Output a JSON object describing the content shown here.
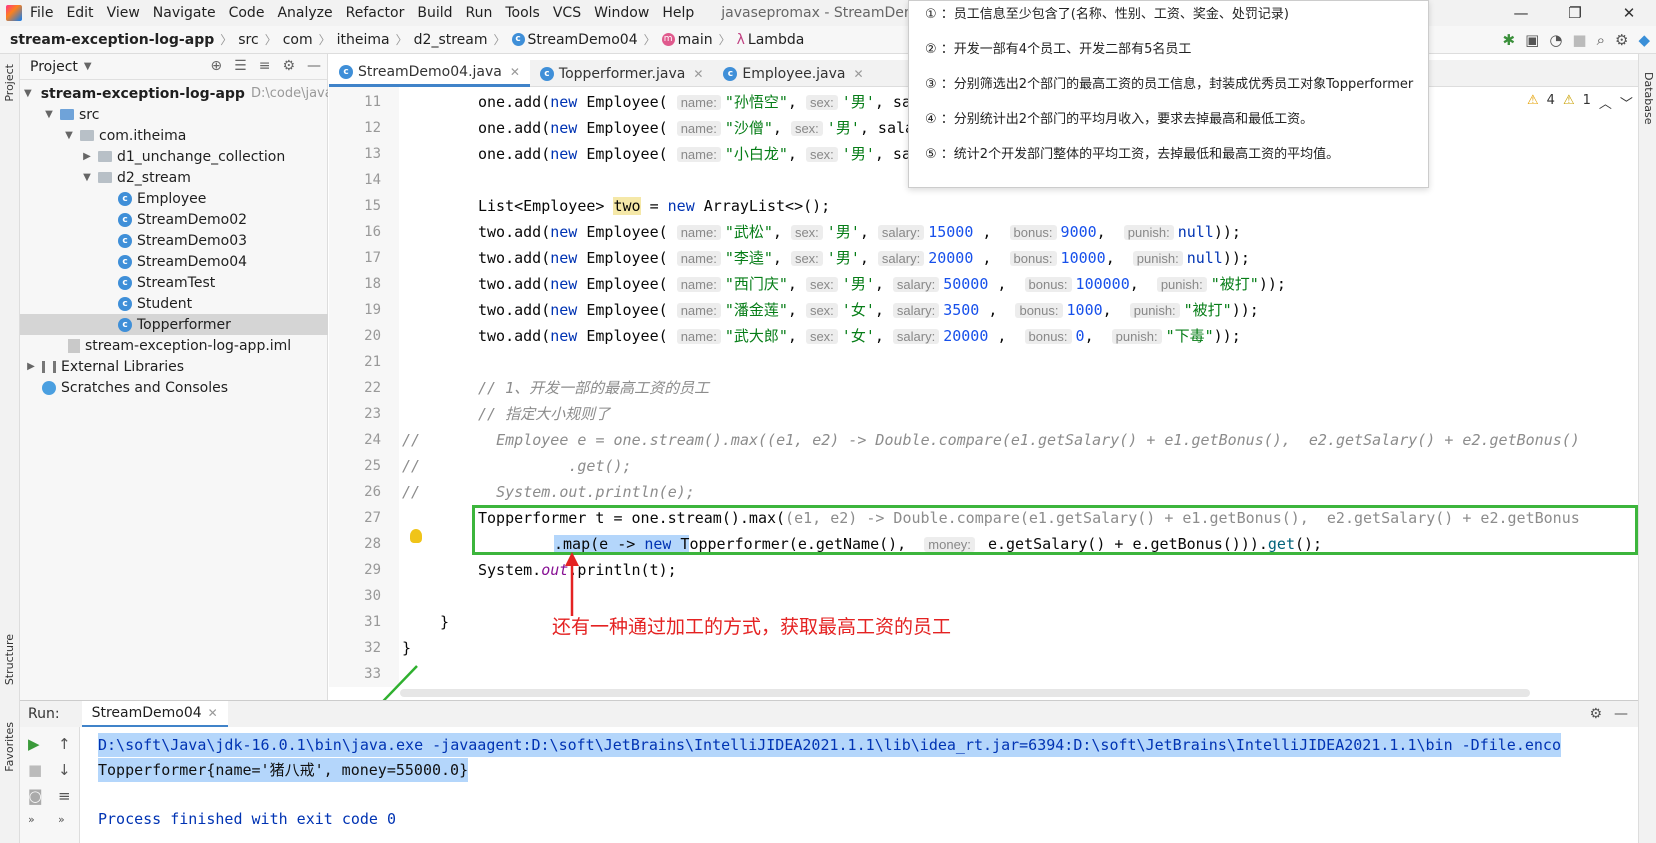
{
  "menubar": {
    "items": [
      "File",
      "Edit",
      "View",
      "Navigate",
      "Code",
      "Analyze",
      "Refactor",
      "Build",
      "Run",
      "Tools",
      "VCS",
      "Window",
      "Help"
    ],
    "title": "javasepromax - StreamDemo04.jav"
  },
  "window": {
    "minimize": "—",
    "restore": "❐",
    "close": "✕"
  },
  "breadcrumb": {
    "project": "stream-exception-log-app",
    "items": [
      "src",
      "com",
      "itheima",
      "d2_stream",
      "StreamDemo04",
      "main",
      "Lambda"
    ]
  },
  "project_panel": {
    "title": "Project",
    "root": "stream-exception-log-app",
    "root_path": "D:\\code\\java",
    "src": "src",
    "pkg": "com.itheima",
    "folders": [
      "d1_unchange_collection",
      "d2_stream"
    ],
    "classes": [
      "Employee",
      "StreamDemo02",
      "StreamDemo03",
      "StreamDemo04",
      "StreamTest",
      "Student",
      "Topperformer"
    ],
    "iml": "stream-exception-log-app.iml",
    "external": "External Libraries",
    "scratches": "Scratches and Consoles"
  },
  "side_labels": {
    "project": "Project",
    "structure": "Structure",
    "favorites": "Favorites",
    "database": "Database"
  },
  "tabs": [
    "StreamDemo04.java",
    "Topperformer.java",
    "Employee.java"
  ],
  "line_numbers": [
    "11",
    "12",
    "13",
    "14",
    "15",
    "16",
    "17",
    "18",
    "19",
    "20",
    "21",
    "22",
    "23",
    "24",
    "25",
    "26",
    "27",
    "28",
    "29",
    "30",
    "31",
    "32",
    "33"
  ],
  "code": {
    "l11": {
      "a": "one.add(",
      "b": "new",
      "c": " Employee(",
      "hint": "name:",
      "s": "\"孙悟空\"",
      "h2": "sex:",
      "s2": "'男'",
      "t": ", sa"
    },
    "l12": {
      "a": "one.add(",
      "b": "new",
      "c": " Employee(",
      "hint": "name:",
      "s": "\"沙僧\"",
      "h2": "sex:",
      "s2": "'男'",
      "t": ", sala"
    },
    "l13": {
      "a": "one.add(",
      "b": "new",
      "c": " Employee(",
      "hint": "name:",
      "s": "\"小白龙\"",
      "h2": "sex:",
      "s2": "'男'",
      "t": ", sa"
    },
    "l15": {
      "a": "List<Employee> ",
      "v": "two",
      "b": " = ",
      "k": "new",
      "c": " ArrayList<>();"
    },
    "rows": [
      {
        "name": "\"武松\"",
        "sex": "'男'",
        "salary": "15000",
        "bonus": "9000",
        "punish": "null"
      },
      {
        "name": "\"李逵\"",
        "sex": "'男'",
        "salary": "20000",
        "bonus": "10000",
        "punish": "null"
      },
      {
        "name": "\"西门庆\"",
        "sex": "'男'",
        "salary": "50000",
        "bonus": "100000",
        "punish": "\"被打\""
      },
      {
        "name": "\"潘金莲\"",
        "sex": "'女'",
        "salary": "3500",
        "bonus": "1000",
        "punish": "\"被打\""
      },
      {
        "name": "\"武大郎\"",
        "sex": "'女'",
        "salary": "20000",
        "bonus": "0",
        "punish": "\"下毒\""
      }
    ],
    "l22": "// 1、开发一部的最高工资的员工",
    "l23": "// 指定大小规则了",
    "l24a": "//",
    "l24b": "  Employee e = one.stream().max((e1, e2) -> Double.compare(e1.getSalary() + e1.getBonus(),  e2.getSalary() + e2.getBonus()",
    "l25a": "//",
    "l25b": "          .get();",
    "l26a": "//",
    "l26b": "  System.out.println(e);",
    "l27a": "Topperformer t = one.stream().max(",
    "l27b": "(e1, e2) -> Double.compare(e1.getSalary() + e1.getBonus(),  e2.getSalary() + e2.getBonus",
    "l28a": ".map(e -> ",
    "l28k": "new",
    "l28b": " T",
    "l28c": "opperformer(e.getName(), ",
    "l28h": "money:",
    "l28d": " e.getSalary() + e.getBonus())).",
    "l28e": "get",
    "l28f": "();",
    "l29a": "System.",
    "l29b": "out",
    "l29c": ".println(t);",
    "l31": "}",
    "l32": "}"
  },
  "annotation": "还有一种通过加工的方式，获取最高工资的员工",
  "notes": [
    {
      "n": "①",
      "text": "：员工信息至少包含了(名称、性别、工资、奖金、处罚记录)"
    },
    {
      "n": "②",
      "text": "：开发一部有4个员工、开发二部有5名员工"
    },
    {
      "n": "③",
      "text": "：分别筛选出2个部门的最高工资的员工信息，封装成优秀员工对象Topperformer"
    },
    {
      "n": "④",
      "text": "：分别统计出2个部门的平均月收入，要求去掉最高和最低工资。"
    },
    {
      "n": "⑤",
      "text": "：统计2个开发部门整体的平均工资，去掉最低和最高工资的平均值。"
    }
  ],
  "inspections": {
    "warnings": "4",
    "weak": "1"
  },
  "run": {
    "label": "Run:",
    "tab": "StreamDemo04",
    "line1": "D:\\soft\\Java\\jdk-16.0.1\\bin\\java.exe -javaagent:D:\\soft\\JetBrains\\IntelliJIDEA2021.1.1\\lib\\idea_rt.jar=6394:D:\\soft\\JetBrains\\IntelliJIDEA2021.1.1\\bin -Dfile.enco",
    "line2": "Topperformer{name='猪八戒', money=55000.0}",
    "line3": "Process finished with exit code 0"
  },
  "colors": {
    "accent": "#4083c9",
    "highlight_box": "#3cb53c",
    "annotation": "#e42222"
  }
}
